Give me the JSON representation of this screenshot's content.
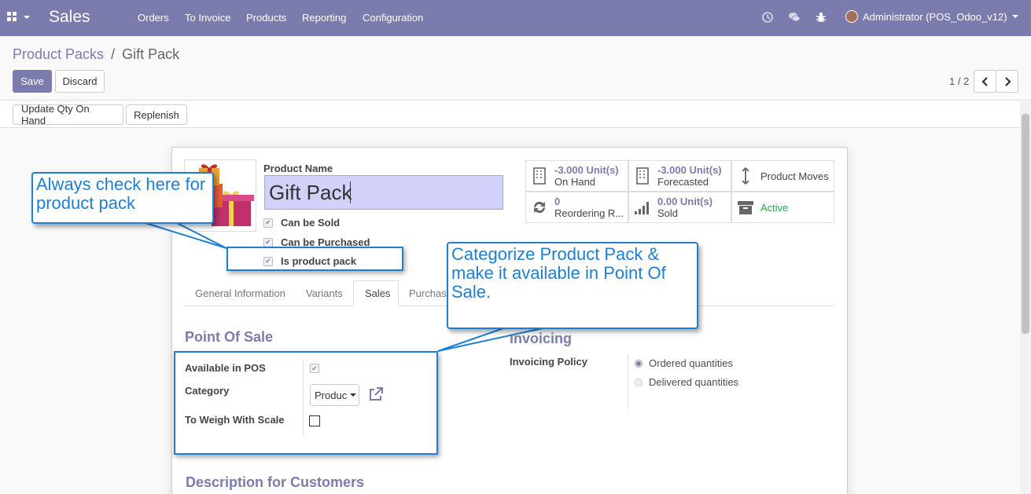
{
  "navbar": {
    "brand": "Sales",
    "menu": [
      "Orders",
      "To Invoice",
      "Products",
      "Reporting",
      "Configuration"
    ],
    "user": "Administrator (POS_Odoo_v12)",
    "icons": [
      "clock-icon",
      "chat-icon",
      "bug-icon"
    ]
  },
  "breadcrumb": {
    "parent": "Product Packs",
    "sep": "/",
    "current": "Gift Pack"
  },
  "buttons": {
    "save": "Save",
    "discard": "Discard",
    "update_qty": "Update Qty On Hand",
    "replenish": "Replenish"
  },
  "pager": "1 / 2",
  "form": {
    "product_name_label": "Product Name",
    "product_name": "Gift Pack",
    "checks": [
      {
        "label": "Can be Sold",
        "checked": true
      },
      {
        "label": "Can be Purchased",
        "checked": true
      },
      {
        "label": "Is product pack",
        "checked": true
      }
    ]
  },
  "smart_buttons": [
    {
      "value": "-3.000 Unit(s)",
      "label": "On Hand",
      "icon": "building-icon"
    },
    {
      "value": "-3.000 Unit(s)",
      "label": "Forecasted",
      "icon": "building-icon"
    },
    {
      "value": "",
      "label": "Product Moves",
      "icon": "updown-arrow-icon"
    },
    {
      "value": "0",
      "label": "Reordering R...",
      "icon": "refresh-icon"
    },
    {
      "value": "0.00 Unit(s)",
      "label": "Sold",
      "icon": "signal-icon"
    },
    {
      "value": "",
      "label": "Active",
      "icon": "archive-icon"
    }
  ],
  "tabs": [
    "General Information",
    "Variants",
    "Sales",
    "Purchas"
  ],
  "pos": {
    "title": "Point Of Sale",
    "available_label": "Available in POS",
    "category_label": "Category",
    "category_value": "Produc",
    "weigh_label": "To Weigh With Scale"
  },
  "invoicing": {
    "title": "Invoicing",
    "policy_label": "Invoicing Policy",
    "options": [
      "Ordered quantities",
      "Delivered quantities"
    ],
    "selected": "Ordered quantities"
  },
  "description_title": "Description for Customers",
  "callouts": {
    "pack": "Always check here for product pack",
    "pos": "Categorize Product Pack & make it available in Point Of Sale."
  },
  "colors": {
    "brand": "#7c7bad",
    "callout": "#1e7fd2",
    "active": "#28a745"
  }
}
